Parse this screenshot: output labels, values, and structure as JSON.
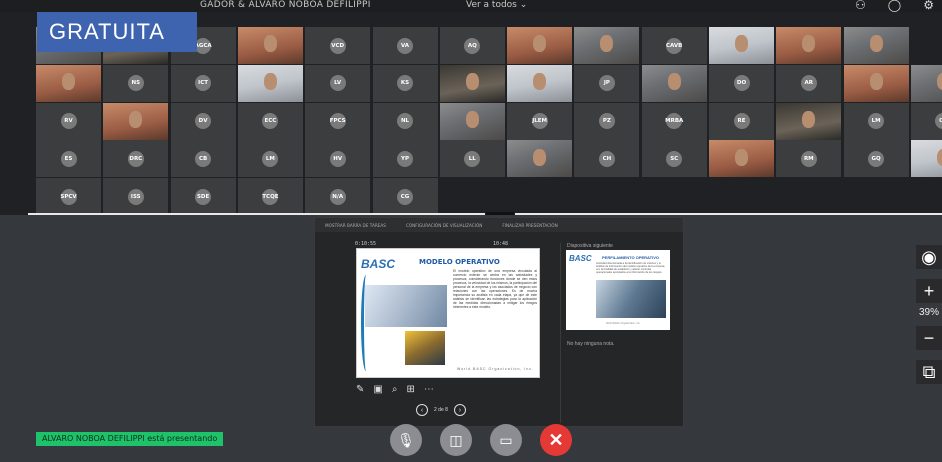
{
  "topbar": {
    "meeting_title": "GADOR & ALVARO NOBOA DEFILIPPI",
    "view_all": "Ver a todos",
    "icons": [
      "people-icon",
      "chat-icon",
      "settings-icon"
    ]
  },
  "badge": "GRATUITA",
  "participants": [
    [
      "",
      "",
      "AGCA",
      "",
      "VCD",
      "VA",
      "AQ",
      "",
      "",
      "CAVB",
      "",
      "",
      ""
    ],
    [
      "",
      "NS",
      "ICT",
      "",
      "LV",
      "KS",
      "",
      "",
      "JP",
      "",
      "DO",
      "AR",
      "",
      ""
    ],
    [
      "RV",
      "",
      "DV",
      "ECC",
      "FPCS",
      "NL",
      "",
      "JLEM",
      "PZ",
      "MRBA",
      "RE",
      "",
      "LM",
      "CH"
    ],
    [
      "ES",
      "DRC",
      "CB",
      "LM",
      "HV",
      "YP",
      "LL",
      "",
      "CH",
      "SC",
      "",
      "RM",
      "GQ",
      ""
    ],
    [
      "SPCV",
      "ISS",
      "SDE",
      "TCQE",
      "N/A",
      "CG"
    ]
  ],
  "share": {
    "toolbar": [
      "MOSTRAR BARRA DE TAREAS",
      "CONFIGURACIÓN DE VISUALIZACIÓN",
      "FINALIZAR PRESENTACIÓN"
    ],
    "elapsed": "0:10:55",
    "clock": "10:48",
    "slide_title": "MODELO OPERATIVO",
    "slide_body": "El modelo operativo de una empresa vinculada al comercio exterior se centra en las actividades y procesos, considerando funciones donde se den estos procesos, la velocidad de los mismos, la participación del personal de la empresa y los asociados de negocio con relaciones con las operaciones. Es de mucha importancia su análisis en cada etapa, ya que de este análisis se identifican las estrategias para la aplicación de las medidas direccionadas a mitigar los riesgos inherentes a este modelo.",
    "slide_footer": "World BASC Organization, Inc.",
    "logo_text": "BASC",
    "next_label": "Diapositiva siguiente",
    "next_title": "PERFILAMIENTO OPERATIVO",
    "next_body": "Actividad direccionada a la identificación de criterios y el análisis de información del modelo operativo de la empresa, con la finalidad de establecer y aplicar controles operacionales apropiados a la información de los riesgos.",
    "next_footer": "World BASC Organization, Inc.",
    "notes": "No hay ninguna nota.",
    "page": "2 de 8",
    "tools": [
      "✎",
      "▣",
      "⌕",
      "⊞",
      "⋯"
    ]
  },
  "zoom": {
    "percent": "39%",
    "plus": "+",
    "minus": "−",
    "camera": "◉",
    "popout": "⧉"
  },
  "status": {
    "presenting": "ALVARO NOBOA DEFILIPPI está presentando"
  },
  "controls": {
    "mute": "🎙",
    "video": "◫",
    "share": "▭",
    "end": "✕"
  }
}
